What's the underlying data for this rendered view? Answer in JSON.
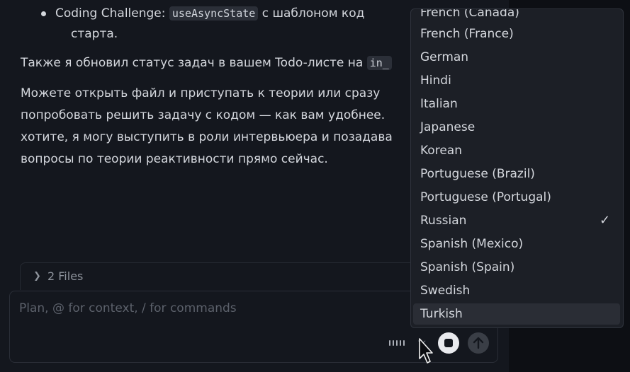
{
  "chat": {
    "bullet_label": "Coding Challenge:",
    "bullet_code": "useAsyncState",
    "bullet_rest": "с шаблоном код",
    "bullet_cont": "старта.",
    "p1_text": "Также я обновил статус задач в вашем Todo-листе на",
    "p1_code": "in_",
    "p2_lines": [
      "Можете открыть файл и приступать к теории или сразу",
      "попробовать решить задачу с кодом — как вам удобнее.",
      "хотите, я могу выступить в роли интервьюера и позадава",
      "вопросы по теории реактивности прямо сейчас."
    ]
  },
  "files": {
    "label": "2 Files"
  },
  "composer": {
    "placeholder": "Plan, @ for context, / for commands"
  },
  "language_menu": {
    "items": [
      "French (Canada)",
      "French (France)",
      "German",
      "Hindi",
      "Italian",
      "Japanese",
      "Korean",
      "Portuguese (Brazil)",
      "Portuguese (Portugal)",
      "Russian",
      "Spanish (Mexico)",
      "Spanish (Spain)",
      "Swedish",
      "Turkish"
    ],
    "selected": "Russian",
    "highlighted": "Turkish"
  }
}
